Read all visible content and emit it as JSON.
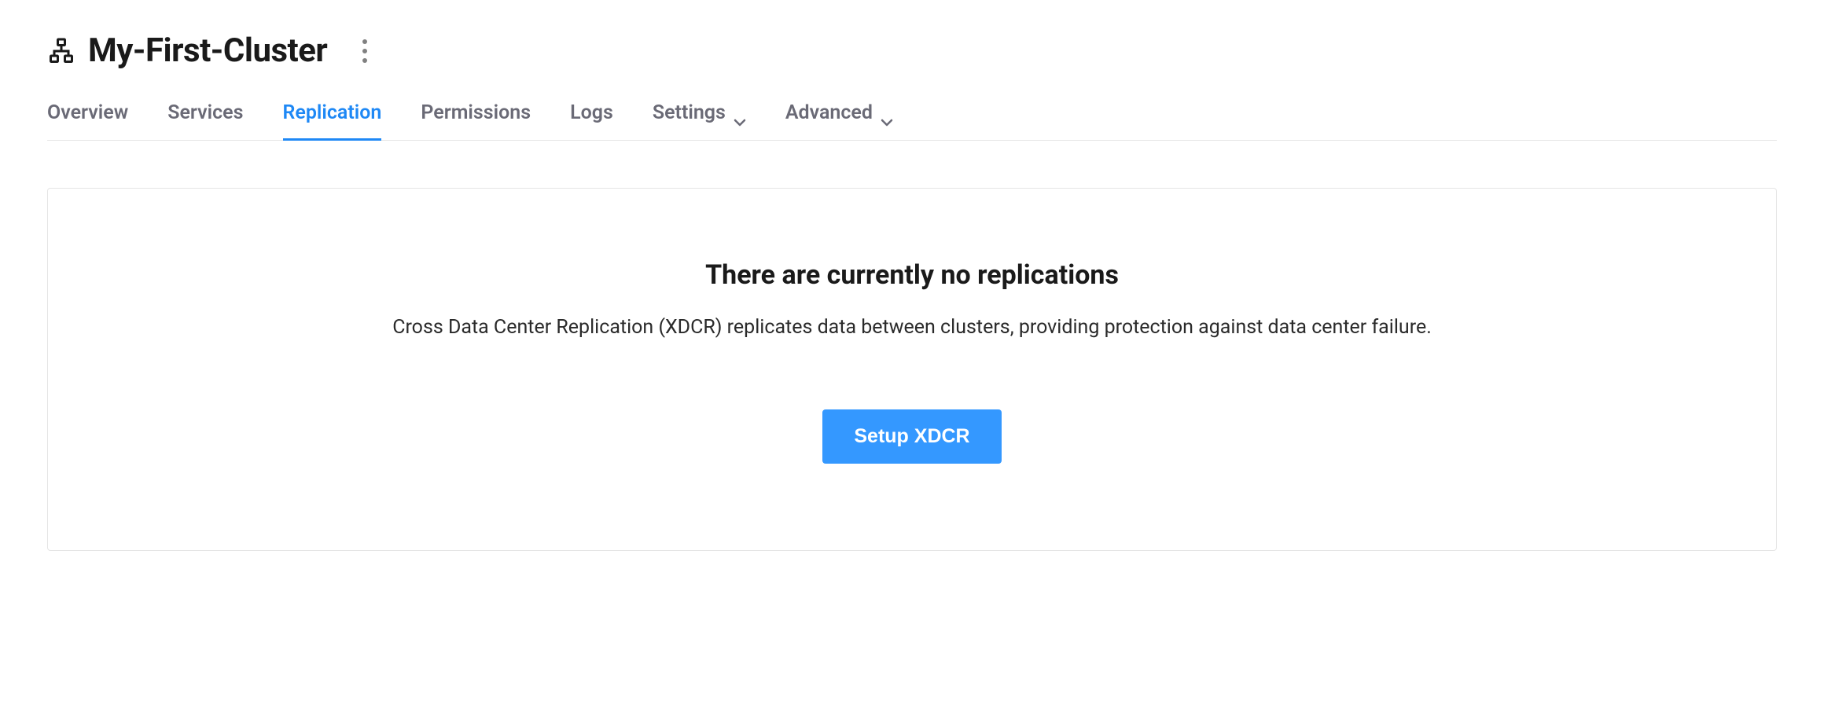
{
  "header": {
    "title": "My-First-Cluster"
  },
  "tabs": [
    {
      "label": "Overview",
      "active": false,
      "dropdown": false
    },
    {
      "label": "Services",
      "active": false,
      "dropdown": false
    },
    {
      "label": "Replication",
      "active": true,
      "dropdown": false
    },
    {
      "label": "Permissions",
      "active": false,
      "dropdown": false
    },
    {
      "label": "Logs",
      "active": false,
      "dropdown": false
    },
    {
      "label": "Settings",
      "active": false,
      "dropdown": true
    },
    {
      "label": "Advanced",
      "active": false,
      "dropdown": true
    }
  ],
  "empty": {
    "title": "There are currently no replications",
    "description": "Cross Data Center Replication (XDCR) replicates data between clusters, providing protection against data center failure.",
    "buttonLabel": "Setup XDCR"
  }
}
